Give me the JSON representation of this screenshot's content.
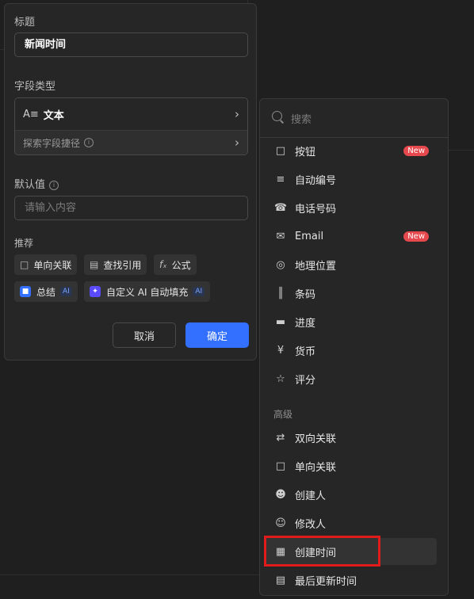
{
  "panel": {
    "title_label": "标题",
    "title_value": "新闻时间",
    "field_type_label": "字段类型",
    "field_type_value": "文本",
    "field_type_icon": "text-icon",
    "explore_label": "探索字段捷径",
    "default_label": "默认值",
    "default_placeholder": "请输入内容",
    "recommend_label": "推荐",
    "chips": [
      {
        "label": "单向关联",
        "icon": "link-icon"
      },
      {
        "label": "查找引用",
        "icon": "lookup-icon"
      },
      {
        "label": "公式",
        "icon": "formula-icon"
      },
      {
        "label": "总结",
        "icon": "summary-icon",
        "tag": "AI"
      },
      {
        "label": "自定义 AI 自动填充",
        "icon": "ai-sparkle-icon",
        "tag": "AI"
      }
    ],
    "cancel_label": "取消",
    "ok_label": "确定"
  },
  "menu": {
    "search_placeholder": "搜索",
    "basic_items": [
      {
        "label": "按钮",
        "icon": "button-icon",
        "badge": "New"
      },
      {
        "label": "自动编号",
        "icon": "auto-number-icon"
      },
      {
        "label": "电话号码",
        "icon": "phone-icon"
      },
      {
        "label": "Email",
        "icon": "email-icon",
        "badge": "New"
      },
      {
        "label": "地理位置",
        "icon": "location-icon"
      },
      {
        "label": "条码",
        "icon": "barcode-icon"
      },
      {
        "label": "进度",
        "icon": "progress-icon"
      },
      {
        "label": "货币",
        "icon": "currency-icon"
      },
      {
        "label": "评分",
        "icon": "star-icon"
      }
    ],
    "advanced_title": "高级",
    "advanced_items": [
      {
        "label": "双向关联",
        "icon": "two-way-link-icon"
      },
      {
        "label": "单向关联",
        "icon": "one-way-link-icon"
      },
      {
        "label": "创建人",
        "icon": "creator-icon"
      },
      {
        "label": "修改人",
        "icon": "modifier-icon"
      },
      {
        "label": "创建时间",
        "icon": "created-time-icon"
      },
      {
        "label": "最后更新时间",
        "icon": "updated-time-icon"
      }
    ]
  },
  "colors": {
    "background": "#1f1f1f",
    "panel": "#262626",
    "primary": "#3370ff",
    "new_badge": "#e5484d",
    "highlight_box": "#e01b1b"
  }
}
